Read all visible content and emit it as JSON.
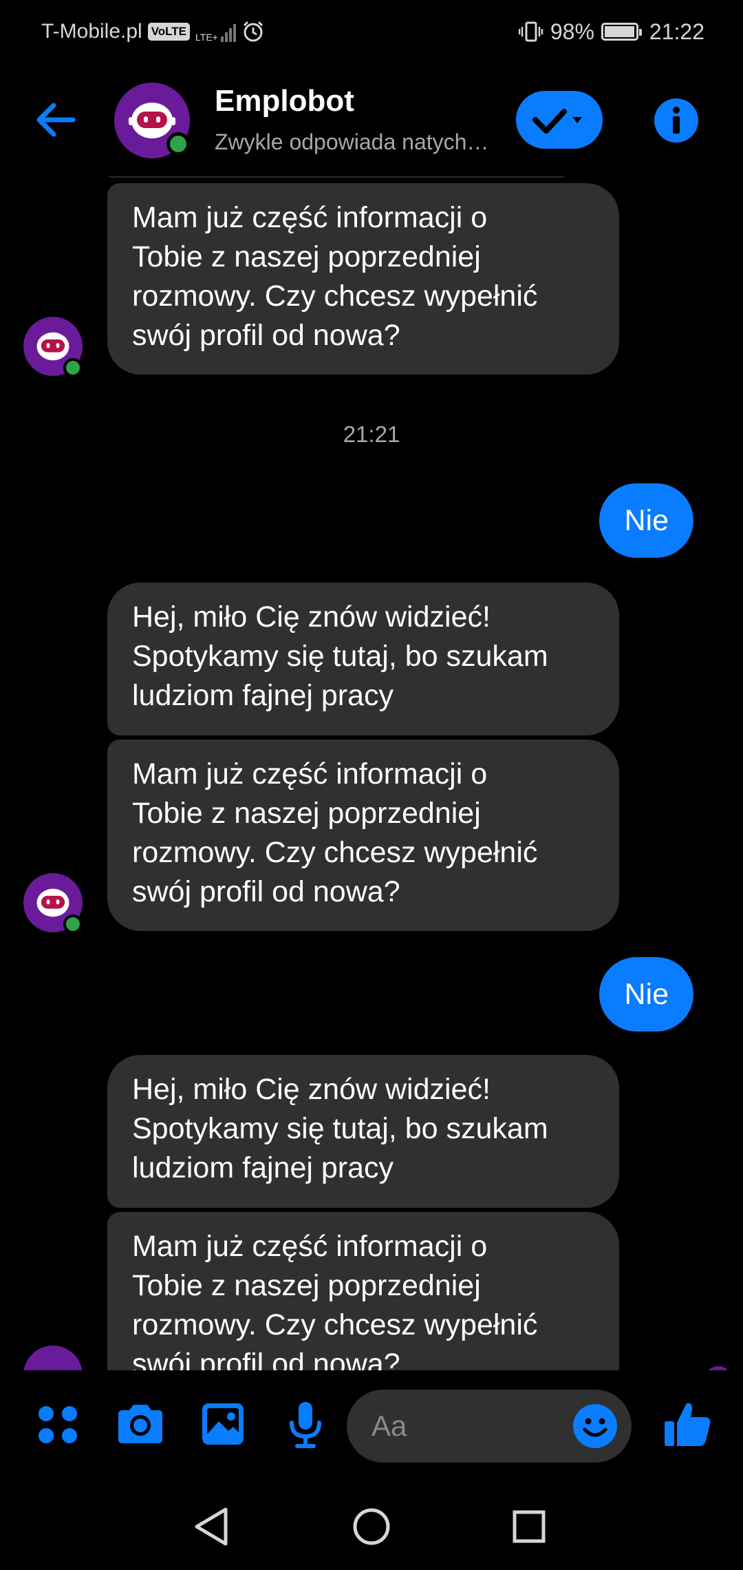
{
  "status_bar": {
    "carrier": "T-Mobile.pl",
    "volte": "VoLTE",
    "lte": "LTE+",
    "battery_percent": "98%",
    "battery_level": 0.98,
    "time": "21:22"
  },
  "header": {
    "title": "Emplobot",
    "subtitle": "Zwykle odpowiada natychmiast"
  },
  "messages": [
    {
      "from": "bot",
      "text": "Mam już część informacji o\nTobie z naszej poprzedniej\nrozmowy. Czy chcesz wypełnić\nswój profil od nowa?"
    },
    {
      "type": "timestamp",
      "text": "21:21"
    },
    {
      "from": "me",
      "text": "Nie"
    },
    {
      "from": "bot",
      "text": "Hej, miło Cię znów widzieć!\nSpotykamy się tutaj, bo szukam\nludziom fajnej pracy"
    },
    {
      "from": "bot",
      "text": "Mam już część informacji o\nTobie z naszej poprzedniej\nrozmowy. Czy chcesz wypełnić\nswój profil od nowa?"
    },
    {
      "from": "me",
      "text": "Nie"
    },
    {
      "from": "bot",
      "text": "Hej, miło Cię znów widzieć!\nSpotykamy się tutaj, bo szukam\nludziom fajnej pracy"
    },
    {
      "from": "bot",
      "text": "Mam już część informacji o\nTobie z naszej poprzedniej\nrozmowy. Czy chcesz wypełnić\nswój profil od nowa?"
    }
  ],
  "composer": {
    "placeholder": "Aa"
  },
  "colors": {
    "accent": "#0a7cff",
    "bot_bubble": "#303030",
    "online": "#31a24c",
    "avatar_bg": "#6a1b9a"
  },
  "icons": [
    "back-arrow-icon",
    "check-icon",
    "info-icon",
    "apps-icon",
    "camera-icon",
    "gallery-icon",
    "microphone-icon",
    "smiley-icon",
    "thumbs-up-icon",
    "nav-back-icon",
    "nav-home-icon",
    "nav-recents-icon"
  ]
}
